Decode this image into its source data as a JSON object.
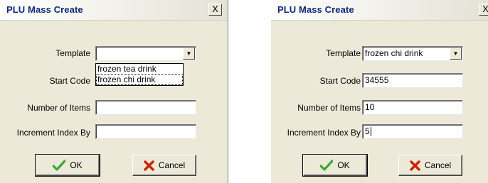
{
  "left": {
    "title": "PLU Mass Create",
    "close_label": "X",
    "labels": {
      "template": "Template",
      "start_code": "Start Code",
      "number_of_items": "Number of Items",
      "increment_index_by": "Increment Index By"
    },
    "template_value": "",
    "dropdown_options": [
      "frozen tea drink",
      "frozen chi drink"
    ],
    "start_code_value": "",
    "number_of_items_value": "",
    "increment_value": "",
    "ok_label": "OK",
    "cancel_label": "Cancel"
  },
  "right": {
    "title": "PLU Mass Create",
    "close_label": "X",
    "labels": {
      "template": "Template",
      "start_code": "Start Code",
      "number_of_items": "Number of Items",
      "increment_index_by": "Increment Index By"
    },
    "template_value": "frozen chi drink",
    "start_code_value": "34555",
    "number_of_items_value": "10",
    "increment_value": "5",
    "ok_label": "OK",
    "cancel_label": "Cancel"
  },
  "colors": {
    "title_text": "#0d2a7a",
    "dialog_bg": "#ece9d8",
    "ok_check": "#3aa63a",
    "cancel_x": "#cc2200"
  },
  "icons": [
    "chevron-down-icon",
    "checkmark-icon",
    "x-icon",
    "close-icon"
  ]
}
